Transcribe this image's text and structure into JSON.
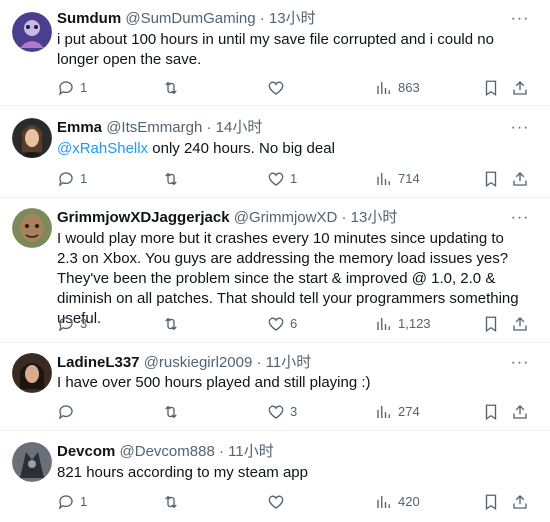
{
  "tweets": [
    {
      "name": "Sumdum",
      "handle": "@SumDumGaming",
      "separator": "·",
      "time": "13小时",
      "text": "i put about 100 hours in until my save file corrupted and i could no longer open the save.",
      "replies": "1",
      "retweets": "",
      "likes": "",
      "views": "863",
      "avatar_color": "#4a3f8f"
    },
    {
      "name": "Emma",
      "handle": "@ItsEmmargh",
      "separator": "·",
      "time": "14小时",
      "mention": "@xRahShellx",
      "text": " only 240 hours. No big deal",
      "replies": "1",
      "retweets": "",
      "likes": "1",
      "views": "714",
      "avatar_color": "#2b2b2b"
    },
    {
      "name": "GrimmjowXDJaggerjack",
      "handle": "@GrimmjowXD",
      "separator": "·",
      "time": "13小时",
      "text": "I would play more but it crashes every 10 minutes since updating to 2.3 on Xbox. You guys are addressing the memory load issues yes? They've been the problem since the start & improved @ 1.0, 2.0 & diminish on all patches. That should tell your programmers something useful.",
      "replies": "3",
      "retweets": "",
      "likes": "6",
      "views": "1,123",
      "avatar_color": "#7a8a5a"
    },
    {
      "name": "LadineL337",
      "handle": "@ruskiegirl2009",
      "separator": "·",
      "time": "11小时",
      "text": "I have over 500 hours played and still playing :)",
      "replies": "",
      "retweets": "",
      "likes": "3",
      "views": "274",
      "avatar_color": "#3a2a22"
    },
    {
      "name": "Devcom",
      "handle": "@Devcom888",
      "separator": "·",
      "time": "11小时",
      "text": "821 hours according to my steam app",
      "replies": "1",
      "retweets": "",
      "likes": "",
      "views": "420",
      "avatar_color": "#6a6f7a"
    }
  ],
  "icons": {
    "reply": "reply-icon",
    "retweet": "retweet-icon",
    "like": "heart-icon",
    "views": "views-icon",
    "bookmark": "bookmark-icon",
    "share": "share-icon",
    "more": "more-icon"
  },
  "colors": {
    "text": "#0f1419",
    "secondary": "#536471",
    "link": "#1d9bf0",
    "divider": "#eff3f4"
  }
}
